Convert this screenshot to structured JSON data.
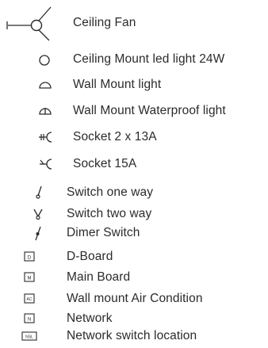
{
  "legend": {
    "items": [
      {
        "symbol": "ceiling-fan-icon",
        "label": "Ceiling Fan"
      },
      {
        "symbol": "circle-icon",
        "label": "Ceiling Mount led light 24W"
      },
      {
        "symbol": "half-circle-icon",
        "label": "Wall Mount  light"
      },
      {
        "symbol": "half-circle-cross-icon",
        "label": "Wall Mount Waterproof light"
      },
      {
        "symbol": "socket-double-icon",
        "label": "Socket 2 x 13A"
      },
      {
        "symbol": "socket-single-icon",
        "label": "Socket  15A"
      },
      {
        "symbol": "switch-one-way-icon",
        "label": "Switch one way"
      },
      {
        "symbol": "switch-two-way-icon",
        "label": "Switch two way"
      },
      {
        "symbol": "dimmer-switch-icon",
        "label": "Dimer Switch"
      },
      {
        "symbol": "box-d-icon",
        "label": "D-Board",
        "box_text": "D"
      },
      {
        "symbol": "box-m-icon",
        "label": "Main Board",
        "box_text": "M"
      },
      {
        "symbol": "box-ac-icon",
        "label": "Wall mount Air Condition",
        "box_text": "AC"
      },
      {
        "symbol": "box-n-icon",
        "label": "Network",
        "box_text": "N"
      },
      {
        "symbol": "box-nsl-icon",
        "label": "Network switch location",
        "box_text": "NSL"
      }
    ]
  },
  "colors": {
    "ink": "#2b2b2b",
    "background": "#ffffff"
  }
}
